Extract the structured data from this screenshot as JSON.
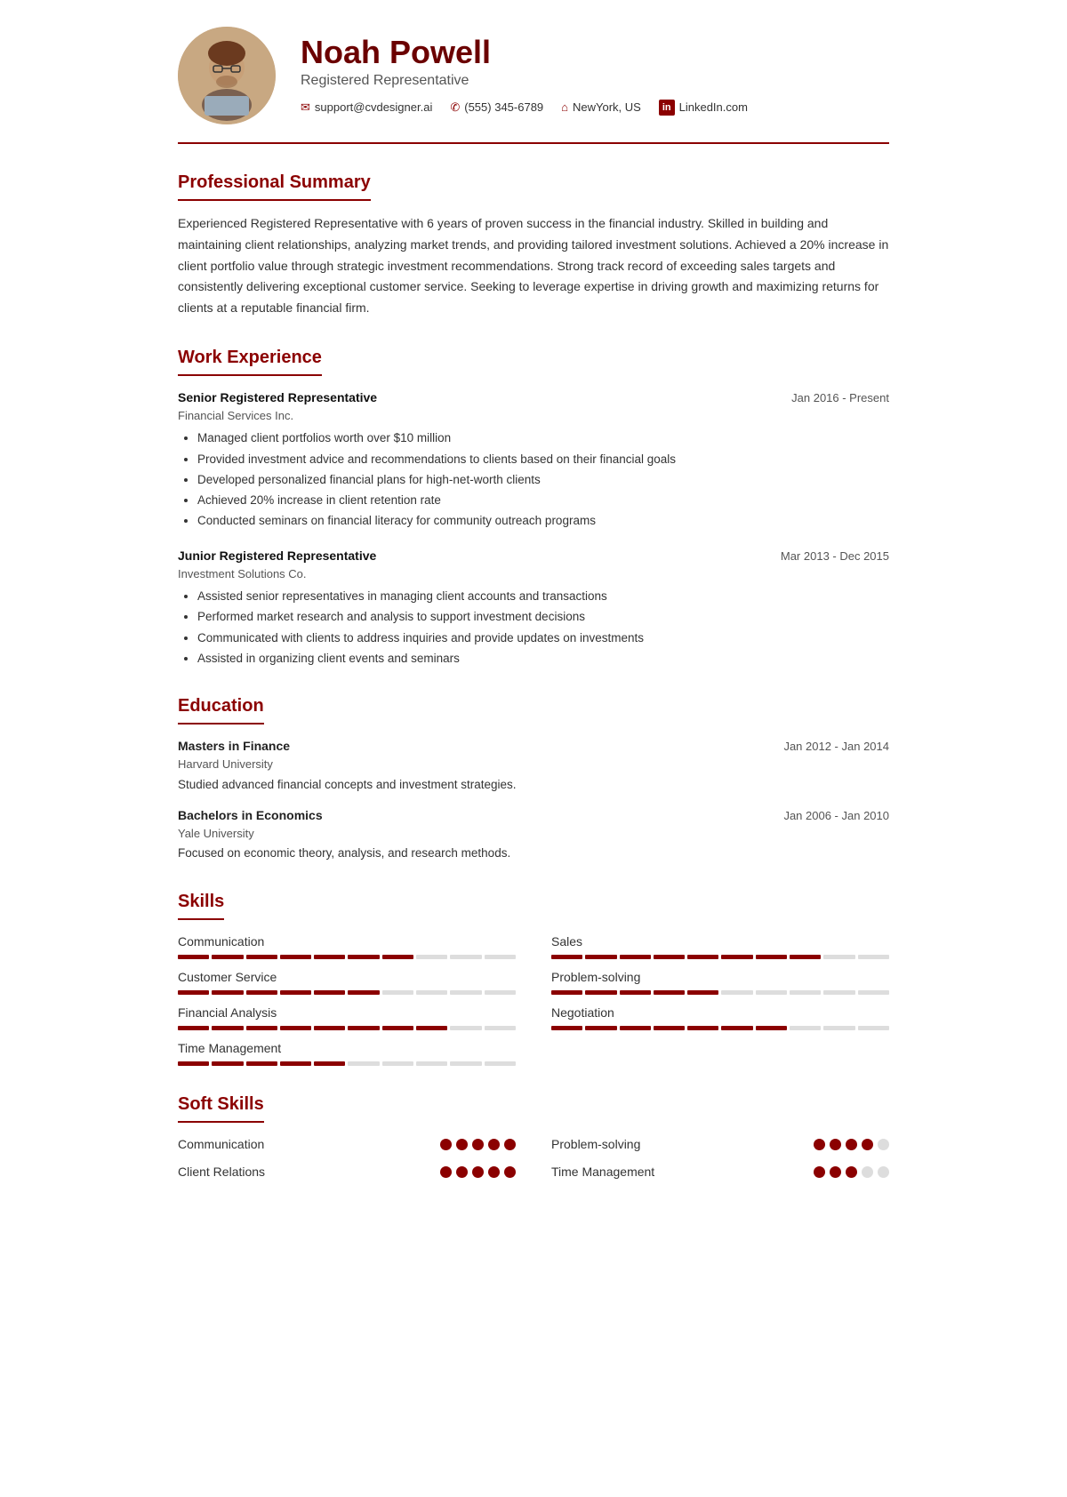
{
  "header": {
    "name": "Noah Powell",
    "title": "Registered Representative",
    "contacts": [
      {
        "type": "email",
        "value": "support@cvdesigner.ai",
        "icon": "✉"
      },
      {
        "type": "phone",
        "value": "(555) 345-6789",
        "icon": "📞"
      },
      {
        "type": "location",
        "value": "NewYork, US",
        "icon": "🏠"
      },
      {
        "type": "linkedin",
        "value": "LinkedIn.com",
        "icon": "in"
      }
    ]
  },
  "sections": {
    "summary": {
      "title": "Professional Summary",
      "text": "Experienced Registered Representative with 6 years of proven success in the financial industry. Skilled in building and maintaining client relationships, analyzing market trends, and providing tailored investment solutions. Achieved a 20% increase in client portfolio value through strategic investment recommendations. Strong track record of exceeding sales targets and consistently delivering exceptional customer service. Seeking to leverage expertise in driving growth and maximizing returns for clients at a reputable financial firm."
    },
    "work_experience": {
      "title": "Work Experience",
      "jobs": [
        {
          "title": "Senior Registered Representative",
          "company": "Financial Services Inc.",
          "date": "Jan 2016 - Present",
          "bullets": [
            "Managed client portfolios worth over $10 million",
            "Provided investment advice and recommendations to clients based on their financial goals",
            "Developed personalized financial plans for high-net-worth clients",
            "Achieved 20% increase in client retention rate",
            "Conducted seminars on financial literacy for community outreach programs"
          ]
        },
        {
          "title": "Junior Registered Representative",
          "company": "Investment Solutions Co.",
          "date": "Mar 2013 - Dec 2015",
          "bullets": [
            "Assisted senior representatives in managing client accounts and transactions",
            "Performed market research and analysis to support investment decisions",
            "Communicated with clients to address inquiries and provide updates on investments",
            "Assisted in organizing client events and seminars"
          ]
        }
      ]
    },
    "education": {
      "title": "Education",
      "items": [
        {
          "degree": "Masters in Finance",
          "school": "Harvard University",
          "date": "Jan 2012 - Jan 2014",
          "desc": "Studied advanced financial concepts and investment strategies."
        },
        {
          "degree": "Bachelors in Economics",
          "school": "Yale University",
          "date": "Jan 2006 - Jan 2010",
          "desc": "Focused on economic theory, analysis, and research methods."
        }
      ]
    },
    "skills": {
      "title": "Skills",
      "items": [
        {
          "name": "Communication",
          "filled": 7,
          "total": 10
        },
        {
          "name": "Sales",
          "filled": 8,
          "total": 10
        },
        {
          "name": "Customer Service",
          "filled": 6,
          "total": 10
        },
        {
          "name": "Problem-solving",
          "filled": 5,
          "total": 10
        },
        {
          "name": "Financial Analysis",
          "filled": 8,
          "total": 10
        },
        {
          "name": "Negotiation",
          "filled": 7,
          "total": 10
        },
        {
          "name": "Time Management",
          "filled": 5,
          "total": 10
        }
      ]
    },
    "soft_skills": {
      "title": "Soft Skills",
      "items": [
        {
          "name": "Communication",
          "filled": 5,
          "total": 5
        },
        {
          "name": "Problem-solving",
          "filled": 4,
          "total": 5
        },
        {
          "name": "Client Relations",
          "filled": 5,
          "total": 5
        },
        {
          "name": "Time Management",
          "filled": 3,
          "total": 5
        }
      ]
    }
  }
}
